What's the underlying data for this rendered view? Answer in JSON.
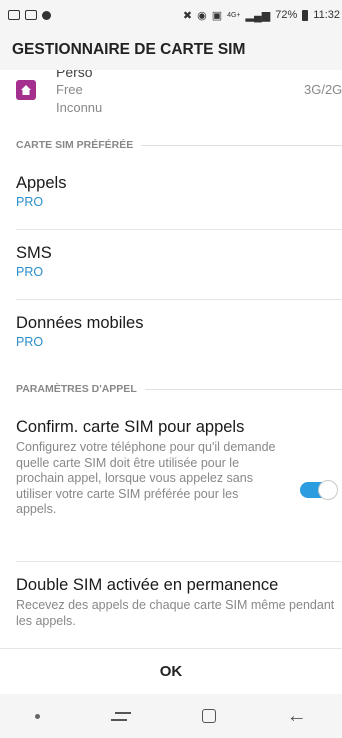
{
  "status_bar": {
    "battery": "72%",
    "time": "11:32",
    "network_label": "4G+"
  },
  "header": {
    "title": "GESTIONNAIRE DE CARTE SIM"
  },
  "sim_card": {
    "name": "Perso",
    "carrier": "Free",
    "status": "Inconnu",
    "network": "3G/2G",
    "icon": "home-icon",
    "icon_color": "#a52f8f"
  },
  "preferred_sim": {
    "section_title": "CARTE SIM PRÉFÉRÉE",
    "items": [
      {
        "label": "Appels",
        "value": "PRO"
      },
      {
        "label": "SMS",
        "value": "PRO"
      },
      {
        "label": "Données mobiles",
        "value": "PRO"
      }
    ]
  },
  "call_settings": {
    "section_title": "PARAMÈTRES D'APPEL",
    "confirm_sim": {
      "title": "Confirm. carte SIM pour appels",
      "description": "Configurez votre téléphone pour qu'il demande quelle carte SIM doit être utilisée pour le prochain appel, lorsque vous appelez sans utiliser votre carte SIM préférée pour les appels.",
      "enabled": true
    },
    "dual_sim": {
      "title": "Double SIM activée en permanence",
      "description": "Recevez des appels de chaque carte SIM même pendant les appels."
    }
  },
  "footer": {
    "ok_label": "OK"
  },
  "colors": {
    "accent": "#2b9ce0",
    "link": "#2b8ecc"
  }
}
